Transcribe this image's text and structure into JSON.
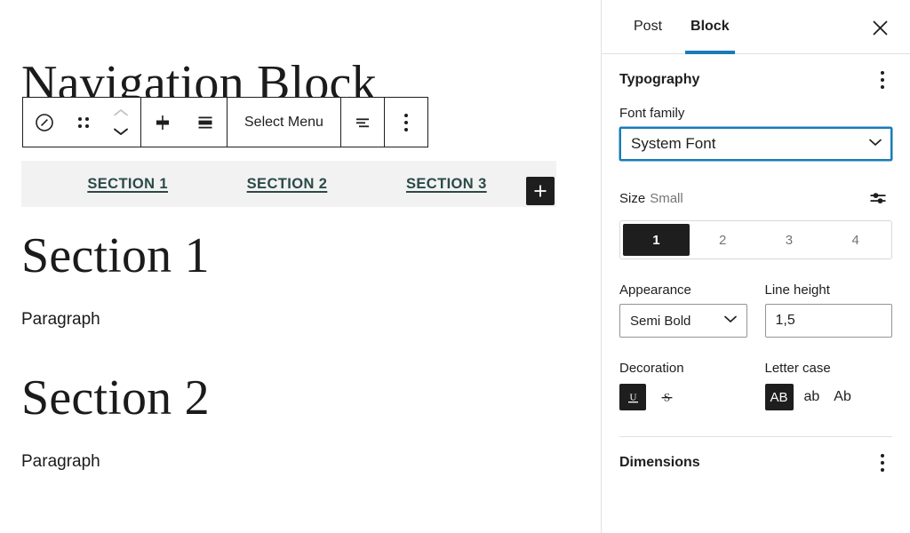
{
  "editor": {
    "clipped_heading": "Navigation Block",
    "toolbar": {
      "block_type_label": "navigation-block-icon",
      "drag_label": "Drag",
      "move_up_label": "Move up",
      "move_down_label": "Move down",
      "vertical_align_label": "Change vertical alignment",
      "justify_label": "Change items justification",
      "select_menu_label": "Select Menu",
      "align_text_label": "Align text",
      "more_options_label": "Options"
    },
    "navigation": {
      "links": [
        {
          "label": "Section 1"
        },
        {
          "label": "Section 2"
        },
        {
          "label": "Section 3"
        }
      ],
      "appender_label": "+",
      "link_color": "#2b4a47",
      "bar_background": "#f2f2f2"
    },
    "content": [
      {
        "heading": "Section 1",
        "paragraph": "Paragraph"
      },
      {
        "heading": "Section 2",
        "paragraph": "Paragraph"
      }
    ]
  },
  "sidebar": {
    "tabs": [
      {
        "label": "Post",
        "active": false
      },
      {
        "label": "Block",
        "active": true
      }
    ],
    "active_tab_accent": "#1b7bb8",
    "close_label": "Close settings",
    "typography": {
      "title": "Typography",
      "kebab_label": "Typography options",
      "font_family": {
        "label": "Font family",
        "value": "System Font"
      },
      "size": {
        "label": "Size",
        "value": "Small",
        "tools_label": "Set custom size",
        "options": [
          "1",
          "2",
          "3",
          "4"
        ],
        "selected_index": 0
      },
      "appearance": {
        "label": "Appearance",
        "value": "Semi Bold"
      },
      "line_height": {
        "label": "Line height",
        "value": "1,5"
      },
      "decoration": {
        "label": "Decoration",
        "options": [
          {
            "glyph": "U",
            "name": "underline",
            "active": true
          },
          {
            "glyph": "S",
            "name": "strikethrough",
            "active": false
          }
        ]
      },
      "letter_case": {
        "label": "Letter case",
        "options": [
          {
            "glyph": "AB",
            "name": "uppercase",
            "active": true
          },
          {
            "glyph": "ab",
            "name": "lowercase",
            "active": false
          },
          {
            "glyph": "Ab",
            "name": "capitalize",
            "active": false
          }
        ]
      }
    },
    "dimensions": {
      "title": "Dimensions",
      "kebab_label": "Dimensions options"
    }
  }
}
